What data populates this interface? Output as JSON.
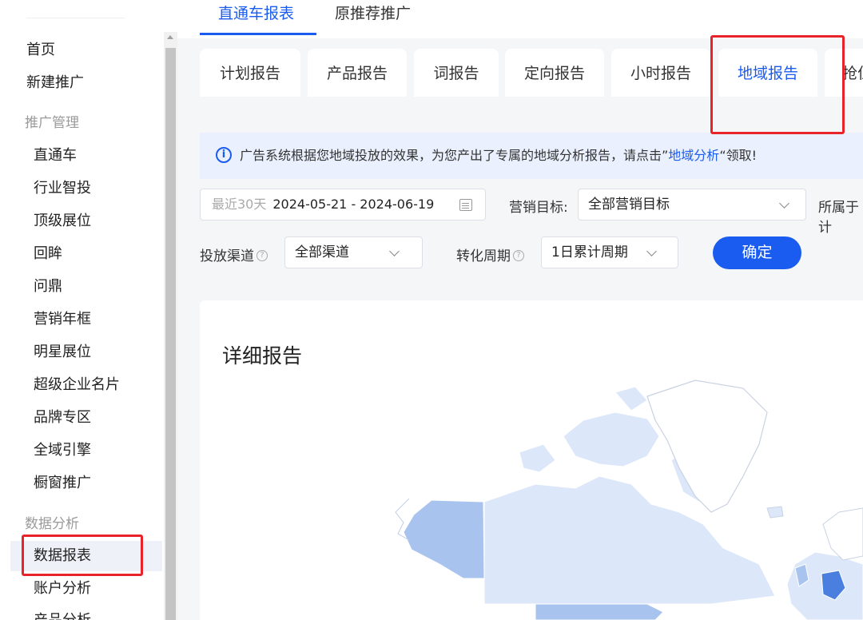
{
  "sidebar": {
    "items": [
      {
        "label": "首页",
        "type": "top-level"
      },
      {
        "label": "新建推广",
        "type": "top-level"
      },
      {
        "label": "推广管理",
        "type": "group"
      },
      {
        "label": "直通车",
        "type": "sub"
      },
      {
        "label": "行业智投",
        "type": "sub"
      },
      {
        "label": "顶级展位",
        "type": "sub"
      },
      {
        "label": "回眸",
        "type": "sub"
      },
      {
        "label": "问鼎",
        "type": "sub"
      },
      {
        "label": "营销年框",
        "type": "sub"
      },
      {
        "label": "明星展位",
        "type": "sub"
      },
      {
        "label": "超级企业名片",
        "type": "sub"
      },
      {
        "label": "品牌专区",
        "type": "sub"
      },
      {
        "label": "全域引擎",
        "type": "sub"
      },
      {
        "label": "橱窗推广",
        "type": "sub"
      },
      {
        "label": "数据分析",
        "type": "group"
      },
      {
        "label": "数据报表",
        "type": "sub",
        "active": true
      },
      {
        "label": "账户分析",
        "type": "sub"
      },
      {
        "label": "产品分析",
        "type": "sub"
      }
    ]
  },
  "top_tabs": [
    {
      "label": "直通车报表",
      "active": true
    },
    {
      "label": "原推荐推广",
      "active": false
    }
  ],
  "report_tabs": [
    {
      "label": "计划报告"
    },
    {
      "label": "产品报告"
    },
    {
      "label": "词报告"
    },
    {
      "label": "定向报告"
    },
    {
      "label": "小时报告"
    },
    {
      "label": "地域报告",
      "active": true
    },
    {
      "label": "抢位"
    }
  ],
  "notice": {
    "text_before": "广告系统根据您地域投放的效果，为您产出了专属的地域分析报告，请点击”",
    "link": "地域分析",
    "text_after": "“领取!"
  },
  "filters": {
    "date_preset": "最近30天",
    "date_range": "2024-05-21 - 2024-06-19",
    "goal_label": "营销目标:",
    "goal_value": "全部营销目标",
    "belongs_label": "所属于计",
    "channel_label": "投放渠道",
    "channel_value": "全部渠道",
    "cycle_label": "转化周期",
    "cycle_value": "1日累计周期",
    "confirm": "确定"
  },
  "detail": {
    "title": "详细报告"
  },
  "colors": {
    "accent": "#1a5cf0",
    "highlight": "#e8232a",
    "map_light": "#dce7f9",
    "map_mid": "#a9c3ef",
    "map_dark": "#4a7fe0"
  }
}
